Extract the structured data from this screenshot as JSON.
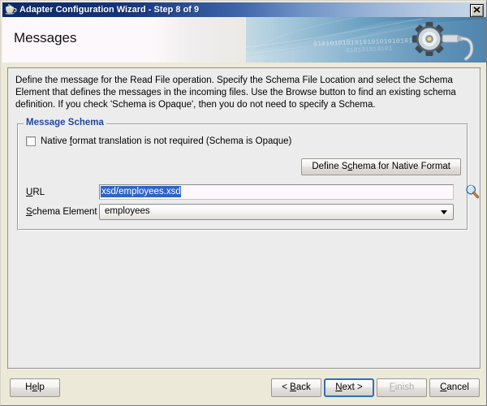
{
  "window": {
    "title": "Adapter Configuration Wizard - Step 8 of 9",
    "icon": "coffee-cup-icon",
    "close_label": "✕"
  },
  "banner": {
    "heading": "Messages",
    "binary_text_1": "01010101010101010101010101",
    "binary_text_2": "010101010101",
    "graphic": "gear-plug-icon"
  },
  "content": {
    "description": "Define the message for the Read File operation.  Specify the Schema File Location and select the Schema Element that defines the messages in the incoming files. Use the Browse button to find an existing schema definition. If you check 'Schema is Opaque', then you do not need to specify a Schema."
  },
  "message_schema": {
    "group_title": "Message Schema",
    "opaque_checkbox": {
      "label_before": "Native ",
      "label_mnemonic": "f",
      "label_after": "ormat translation is not required (Schema is Opaque)",
      "checked": false
    },
    "define_button": {
      "label_before": "Define S",
      "label_mnemonic": "c",
      "label_after": "hema for Native Format"
    },
    "url": {
      "label_mnemonic": "U",
      "label_after": "RL",
      "value": "xsd/employees.xsd",
      "placeholder": "",
      "selected": true
    },
    "browse_icon": "magnifier-icon",
    "schema_element": {
      "label_mnemonic": "S",
      "label_after": "chema Element",
      "value": "employees",
      "options": [
        "employees"
      ]
    }
  },
  "buttons": {
    "help": {
      "before": "H",
      "mnemonic": "e",
      "after": "lp",
      "disabled": false,
      "focused": false
    },
    "back": {
      "before": "< ",
      "mnemonic": "B",
      "after": "ack",
      "disabled": false,
      "focused": false
    },
    "next": {
      "before": "",
      "mnemonic": "N",
      "after": "ext >",
      "disabled": false,
      "focused": true
    },
    "finish": {
      "before": "",
      "mnemonic": "F",
      "after": "inish",
      "disabled": true,
      "focused": false
    },
    "cancel": {
      "before": "",
      "mnemonic": "C",
      "after": "ancel",
      "disabled": false,
      "focused": false
    }
  },
  "colors": {
    "title_gradient_start": "#0b2a6b",
    "group_title": "#22479b",
    "selection": "#2f63c8",
    "focus_ring": "#2f6ec0",
    "panel_bg": "#ececec",
    "field_bg": "#fdf8fb"
  }
}
